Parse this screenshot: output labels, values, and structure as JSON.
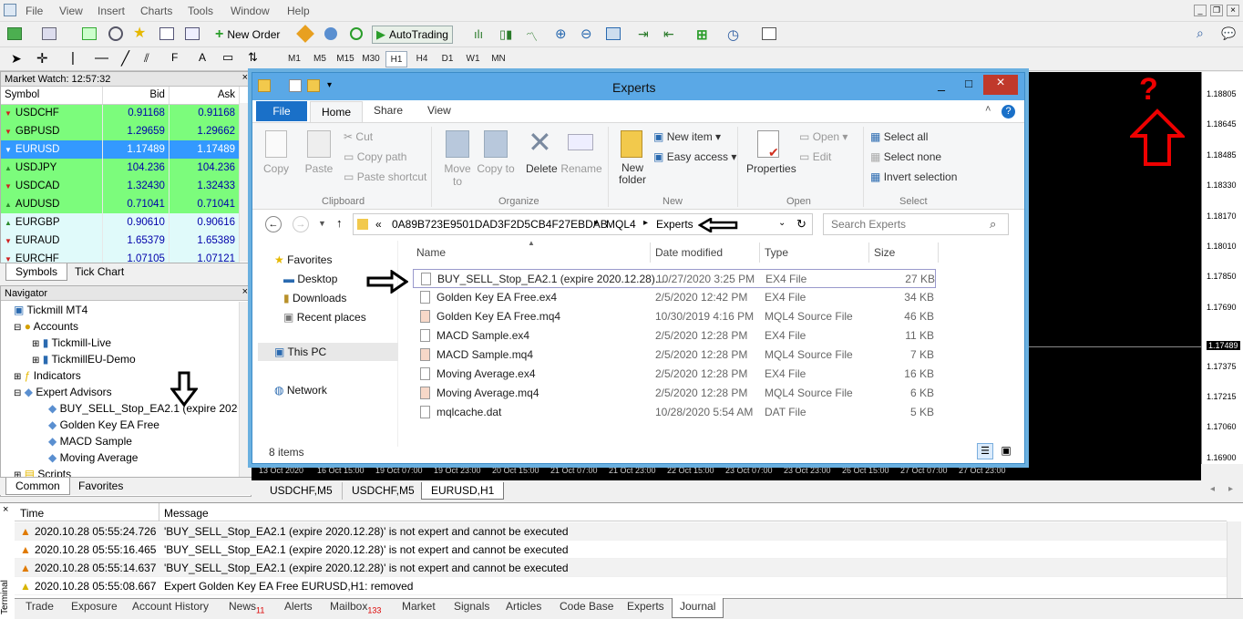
{
  "menu": [
    "File",
    "View",
    "Insert",
    "Charts",
    "Tools",
    "Window",
    "Help"
  ],
  "toolbar": {
    "new_order": "New Order",
    "autotrading": "AutoTrading"
  },
  "timeframes": [
    "M1",
    "M5",
    "M15",
    "M30",
    "H1",
    "H4",
    "D1",
    "W1",
    "MN"
  ],
  "timeframe_selected": "H1",
  "market_watch": {
    "title": "Market Watch: 12:57:32",
    "columns": [
      "Symbol",
      "Bid",
      "Ask"
    ],
    "rows": [
      {
        "symbol": "USDCHF",
        "bid": "0.91168",
        "ask": "0.91168",
        "color": "#7cfc7c",
        "dir": "down"
      },
      {
        "symbol": "GBPUSD",
        "bid": "1.29659",
        "ask": "1.29662",
        "color": "#7cfc7c",
        "dir": "down"
      },
      {
        "symbol": "EURUSD",
        "bid": "1.17489",
        "ask": "1.17489",
        "color": "#3399ff",
        "dir": "down"
      },
      {
        "symbol": "USDJPY",
        "bid": "104.236",
        "ask": "104.236",
        "color": "#7cfc7c",
        "dir": "up"
      },
      {
        "symbol": "USDCAD",
        "bid": "1.32430",
        "ask": "1.32433",
        "color": "#7cfc7c",
        "dir": "down"
      },
      {
        "symbol": "AUDUSD",
        "bid": "0.71041",
        "ask": "0.71041",
        "color": "#7cfc7c",
        "dir": "up"
      },
      {
        "symbol": "EURGBP",
        "bid": "0.90610",
        "ask": "0.90616",
        "color": "#e0fafa",
        "dir": "up"
      },
      {
        "symbol": "EURAUD",
        "bid": "1.65379",
        "ask": "1.65389",
        "color": "#e0fafa",
        "dir": "down"
      },
      {
        "symbol": "EURCHF",
        "bid": "1.07105",
        "ask": "1.07121",
        "color": "#e0fafa",
        "dir": "down"
      }
    ],
    "tabs": [
      "Symbols",
      "Tick Chart"
    ]
  },
  "navigator": {
    "title": "Navigator",
    "root": "Tickmill MT4",
    "accounts": "Accounts",
    "account_items": [
      "Tickmill-Live",
      "TickmillEU-Demo"
    ],
    "indicators": "Indicators",
    "experts": "Expert Advisors",
    "expert_items": [
      "BUY_SELL_Stop_EA2.1 (expire 2020.1",
      "Golden Key EA Free",
      "MACD Sample",
      "Moving Average"
    ],
    "scripts": "Scripts",
    "tabs": [
      "Common",
      "Favorites"
    ]
  },
  "explorer": {
    "title": "Experts",
    "ribbon_tabs": [
      "File",
      "Home",
      "Share",
      "View"
    ],
    "clipboard": {
      "copy": "Copy",
      "paste": "Paste",
      "cut": "Cut",
      "copy_path": "Copy path",
      "paste_shortcut": "Paste shortcut",
      "group": "Clipboard"
    },
    "organize": {
      "move_to": "Move to",
      "copy_to": "Copy to",
      "delete": "Delete",
      "rename": "Rename",
      "group": "Organize"
    },
    "new": {
      "new_folder": "New folder",
      "new_item": "New item",
      "easy_access": "Easy access",
      "group": "New"
    },
    "open": {
      "properties": "Properties",
      "open": "Open",
      "edit": "Edit",
      "group": "Open"
    },
    "select": {
      "select_all": "Select all",
      "select_none": "Select none",
      "invert": "Invert selection",
      "group": "Select"
    },
    "path": [
      "0A89B723E9501DAD3F2D5CB4F27EBDAB",
      "MQL4",
      "Experts"
    ],
    "search_placeholder": "Search Experts",
    "nav_pane": [
      "Favorites",
      "Desktop",
      "Downloads",
      "Recent places",
      "This PC",
      "Network"
    ],
    "columns": [
      "Name",
      "Date modified",
      "Type",
      "Size"
    ],
    "files": [
      {
        "name": "BUY_SELL_Stop_EA2.1 (expire 2020.12.28)....",
        "date": "10/27/2020 3:25 PM",
        "type": "EX4 File",
        "size": "27 KB"
      },
      {
        "name": "Golden Key EA Free.ex4",
        "date": "2/5/2020 12:42 PM",
        "type": "EX4 File",
        "size": "34 KB"
      },
      {
        "name": "Golden Key EA Free.mq4",
        "date": "10/30/2019 4:16 PM",
        "type": "MQL4 Source File",
        "size": "46 KB"
      },
      {
        "name": "MACD Sample.ex4",
        "date": "2/5/2020 12:28 PM",
        "type": "EX4 File",
        "size": "11 KB"
      },
      {
        "name": "MACD Sample.mq4",
        "date": "2/5/2020 12:28 PM",
        "type": "MQL4 Source File",
        "size": "7 KB"
      },
      {
        "name": "Moving Average.ex4",
        "date": "2/5/2020 12:28 PM",
        "type": "EX4 File",
        "size": "16 KB"
      },
      {
        "name": "Moving Average.mq4",
        "date": "2/5/2020 12:28 PM",
        "type": "MQL4 Source File",
        "size": "6 KB"
      },
      {
        "name": "mqlcache.dat",
        "date": "10/28/2020 5:54 AM",
        "type": "DAT File",
        "size": "5 KB"
      }
    ],
    "item_count": "8 items"
  },
  "chart": {
    "prices": [
      "1.18805",
      "1.18645",
      "1.18485",
      "1.18330",
      "1.18170",
      "1.18010",
      "1.17850",
      "1.17690",
      "1.17489",
      "1.17375",
      "1.17215",
      "1.17060",
      "1.16900"
    ],
    "current_price": "1.17489",
    "question_mark": "?",
    "x_labels": [
      "13 Oct 2020",
      "16 Oct 15:00",
      "19 Oct 07:00",
      "19 Oct 23:00",
      "20 Oct 15:00",
      "21 Oct 07:00",
      "21 Oct 23:00",
      "22 Oct 15:00",
      "23 Oct 07:00",
      "23 Oct 23:00",
      "26 Oct 15:00",
      "27 Oct 07:00",
      "27 Oct 23:00"
    ],
    "tabs": [
      "USDCHF,M5",
      "USDCHF,M5",
      "EURUSD,H1"
    ]
  },
  "terminal": {
    "label": "Terminal",
    "columns": [
      "Time",
      "Message"
    ],
    "rows": [
      {
        "time": "2020.10.28 05:55:24.726",
        "msg": "'BUY_SELL_Stop_EA2.1 (expire 2020.12.28)' is not expert and cannot be executed",
        "level": "warn"
      },
      {
        "time": "2020.10.28 05:55:16.465",
        "msg": "'BUY_SELL_Stop_EA2.1 (expire 2020.12.28)' is not expert and cannot be executed",
        "level": "warn"
      },
      {
        "time": "2020.10.28 05:55:14.637",
        "msg": "'BUY_SELL_Stop_EA2.1 (expire 2020.12.28)' is not expert and cannot be executed",
        "level": "warn"
      },
      {
        "time": "2020.10.28 05:55:08.667",
        "msg": "Expert Golden Key EA Free EURUSD,H1: removed",
        "level": "info"
      }
    ],
    "tabs": [
      "Trade",
      "Exposure",
      "Account History",
      "News",
      "Alerts",
      "Mailbox",
      "Market",
      "Signals",
      "Articles",
      "Code Base",
      "Experts",
      "Journal"
    ],
    "news_count": "11",
    "mailbox_count": "133"
  }
}
